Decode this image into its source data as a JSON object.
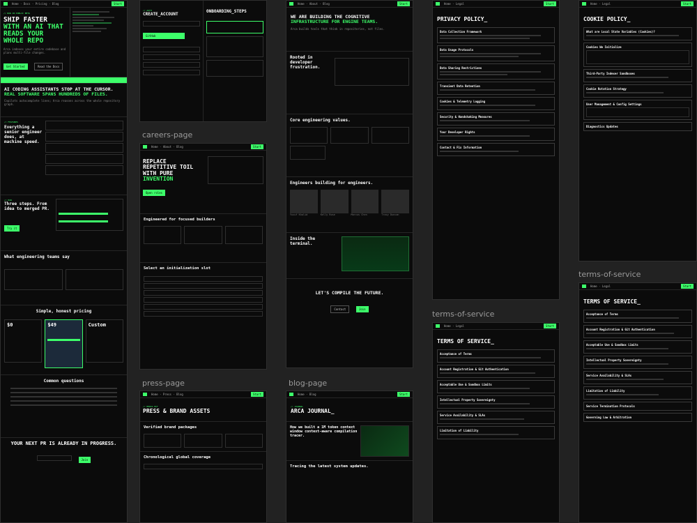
{
  "labels": {
    "careers": "careers-page",
    "press": "press-page",
    "blog": "blog-page",
    "tos1": "terms-of-service",
    "tos2": "terms-of-service"
  },
  "home": {
    "hero1": "SHIP FASTER",
    "hero2": "WITH AN AI THAT",
    "hero3": "READS YOUR",
    "hero4": "WHOLE REPO",
    "cta1": "Get Started",
    "cta2": "Read the Docs",
    "statement1": "AI CODING ASSISTANTS STOP AT THE CURSOR.",
    "statement2": "REAL SOFTWARE SPANS HUNDREDS OF FILES.",
    "everything": "Everything a senior engineer does, at machine speed.",
    "steps": "Three steps. From idea to merged PR.",
    "teams": "What engineering teams say",
    "pricing": "Simple, honest pricing",
    "price1": "$0",
    "price2": "$49",
    "price3": "Custom",
    "questions": "Common questions",
    "final": "YOUR NEXT PR IS ALREADY IN PROGRESS."
  },
  "account": {
    "title1": "CREATE_ACCOUNT",
    "title2": "ONBOARDING_STEPS"
  },
  "careers": {
    "hero1": "REPLACE",
    "hero2": "REPETITIVE TOIL",
    "hero3": "WITH PURE",
    "hero4": "INVENTION",
    "builders": "Engineered for focused builders",
    "slot": "Select an initialization slot"
  },
  "about": {
    "hero1": "WE ARE BUILDING THE COGNITIVE",
    "hero2": "INFRASTRUCTURE FOR ENGINE TEAMS.",
    "rooted": "Rooted in developer frustration.",
    "values": "Core engineering values.",
    "engineers": "Engineers building for engineers.",
    "terminal": "Inside the terminal.",
    "compile": "LET'S COMPILE THE FUTURE.",
    "people": [
      "Yusuf Khalid",
      "Kelly Rose",
      "Marcus Chen",
      "Tracy Duncan"
    ]
  },
  "press": {
    "title": "PRESS & BRAND ASSETS",
    "packages": "Verified brand packages",
    "coverage": "Chronological global coverage"
  },
  "blog": {
    "title": "ARCA JOURNAL_",
    "post": "How we built a 1M token context window context-aware compilation tracer.",
    "latest": "Tracing the latest system updates."
  },
  "privacy": {
    "title": "PRIVACY POLICY_",
    "items": [
      "Data Collection Framework",
      "Data Usage Protocols",
      "Data Sharing Restrictions",
      "Transient Data Retention",
      "Cookies & Telemetry Logging",
      "Security & Handshaking Measures",
      "Your Developer Rights",
      "Contact & Fix Information"
    ]
  },
  "cookie": {
    "title": "COOKIE POLICY_",
    "items": [
      "What are Local State Variables (Cookies)?",
      "Cookies We Initialize",
      "Third-Party Indexer Sandboxes",
      "Cookie Rotation Strategy",
      "User Management & Config Settings",
      "Diagnostics Updates"
    ]
  },
  "tos": {
    "title": "TERMS OF SERVICE_",
    "items": [
      "Acceptance of Terms",
      "Account Registration & Git Authentication",
      "Acceptable Use & Sandbox Limits",
      "Intellectual Property Sovereignty",
      "Service Availability & SLAs",
      "Limitation of Liability"
    ],
    "items2": [
      "Acceptance of Terms",
      "Account Registration & Git Authentication",
      "Acceptable Use & Sandbox Limits",
      "Intellectual Property Sovereignty",
      "Service Availability & SLAs",
      "Limitation of Liability",
      "Service Termination Protocols",
      "Governing Law & Arbitration"
    ]
  },
  "colors": {
    "accent": "#3dff6a",
    "bg": "#0b0b0b",
    "canvas": "#222222"
  }
}
